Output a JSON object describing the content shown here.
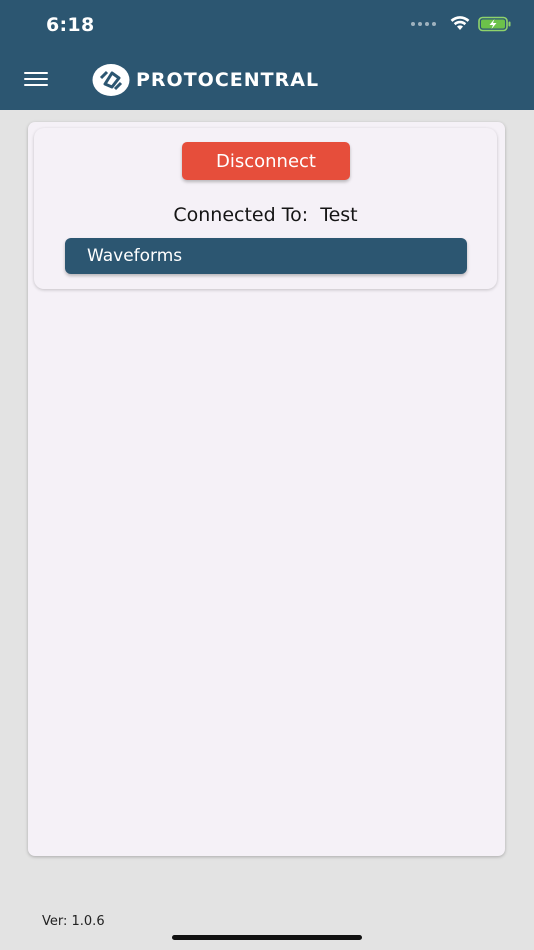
{
  "status_bar": {
    "time": "6:18",
    "icons": [
      "cellular-icon",
      "wifi-icon",
      "battery-charging-icon"
    ]
  },
  "header": {
    "menu_icon": "hamburger-menu-icon",
    "logo_text": "PROTOCENTRAL",
    "background_color": "#2c5671"
  },
  "connection": {
    "disconnect_label": "Disconnect",
    "connected_text": "Connected To:  Test",
    "waveforms_label": "Waveforms",
    "disconnect_color": "#e64e3b",
    "waveforms_color": "#2c5671"
  },
  "footer": {
    "version": "Ver: 1.0.6"
  }
}
